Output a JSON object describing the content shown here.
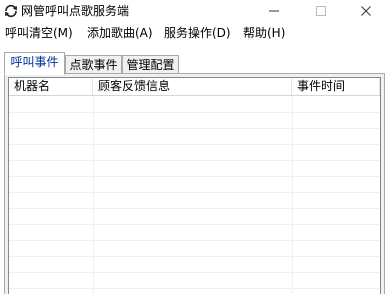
{
  "window": {
    "title": "网管呼叫点歌服务端",
    "icon": "refresh-icon"
  },
  "menu": [
    {
      "label": "呼叫清空(M)"
    },
    {
      "label": "添加歌曲(A)"
    },
    {
      "label": "服务操作(D)"
    },
    {
      "label": "帮助(H)"
    }
  ],
  "tabs": [
    {
      "label": "呼叫事件",
      "active": true
    },
    {
      "label": "点歌事件",
      "active": false
    },
    {
      "label": "管理配置",
      "active": false
    }
  ],
  "list": {
    "columns": [
      {
        "label": "机器名"
      },
      {
        "label": "顾客反馈信息"
      },
      {
        "label": "事件时间"
      }
    ],
    "rows": []
  },
  "colors": {
    "active_tab_text": "#003399",
    "grid_line": "#f0f0f0"
  }
}
